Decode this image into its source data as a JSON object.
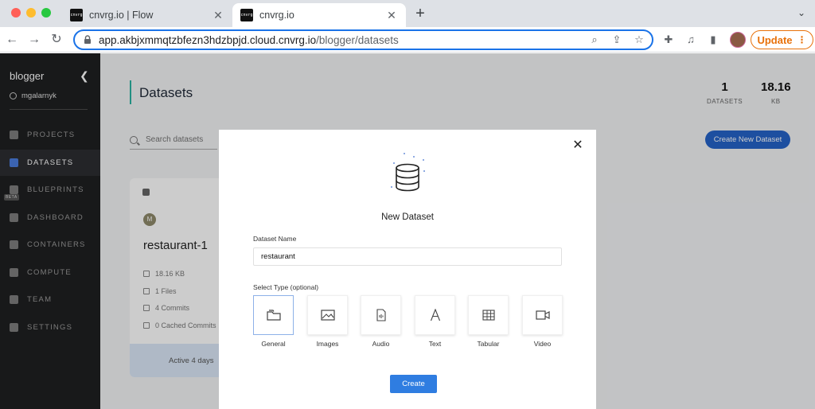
{
  "browser": {
    "tabs": [
      {
        "favicon_text": "cnvrg",
        "title": "cnvrg.io | Flow",
        "close": "✕"
      },
      {
        "favicon_text": "cnvrg",
        "title": "cnvrg.io",
        "close": "✕"
      }
    ],
    "new_tab": "+",
    "url_host": "app.akbjxmmqtzbfezn3hdzbpjd.cloud.cnvrg.io",
    "url_path": "/blogger/datasets",
    "update_label": "Update"
  },
  "sidebar": {
    "org": "blogger",
    "user": "mgalarnyk",
    "items": [
      {
        "label": "PROJECTS",
        "icon": "projects-icon"
      },
      {
        "label": "DATASETS",
        "icon": "datasets-icon"
      },
      {
        "label": "BLUEPRINTS",
        "icon": "blueprints-icon",
        "badge": "BETA"
      },
      {
        "label": "DASHBOARD",
        "icon": "dashboard-icon"
      },
      {
        "label": "CONTAINERS",
        "icon": "containers-icon"
      },
      {
        "label": "COMPUTE",
        "icon": "compute-icon"
      },
      {
        "label": "TEAM",
        "icon": "team-icon"
      },
      {
        "label": "SETTINGS",
        "icon": "settings-icon"
      }
    ]
  },
  "main": {
    "title": "Datasets",
    "stats": [
      {
        "value": "1",
        "label": "DATASETS"
      },
      {
        "value": "18.16",
        "label": "KB"
      }
    ],
    "search_placeholder": "Search datasets",
    "create_button": "Create New Dataset",
    "card": {
      "avatar": "M",
      "title": "restaurant-1",
      "size": "18.16 KB",
      "files": "1 Files",
      "commits": "4 Commits",
      "cached": "0 Cached Commits",
      "footer": "Active 4 days"
    }
  },
  "modal": {
    "title": "New Dataset",
    "name_label": "Dataset Name",
    "name_value": "restaurant",
    "type_label": "Select Type (optional)",
    "types": [
      {
        "label": "General",
        "icon": "folder-icon",
        "selected": true
      },
      {
        "label": "Images",
        "icon": "image-icon"
      },
      {
        "label": "Audio",
        "icon": "audio-file-icon"
      },
      {
        "label": "Text",
        "icon": "text-icon"
      },
      {
        "label": "Tabular",
        "icon": "table-icon"
      },
      {
        "label": "Video",
        "icon": "video-icon"
      }
    ],
    "create_button": "Create",
    "close": "✕"
  }
}
